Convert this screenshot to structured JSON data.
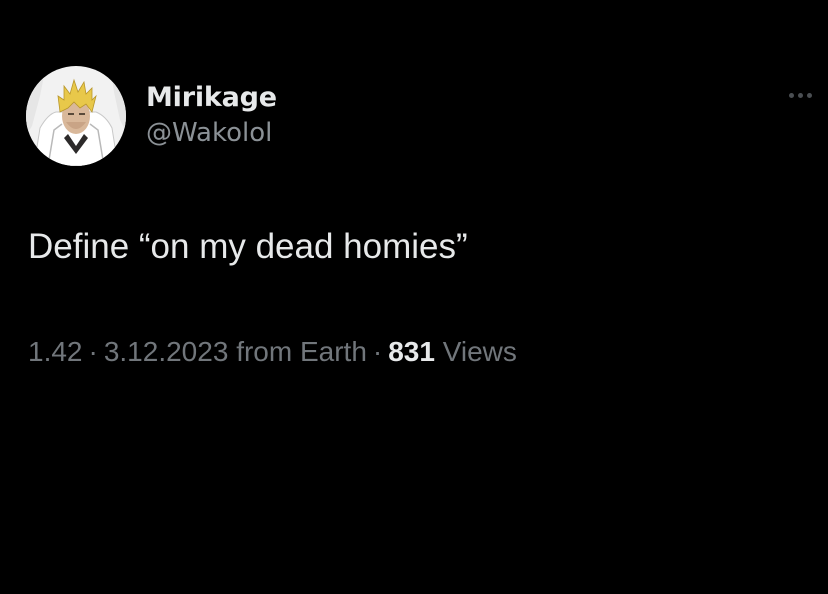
{
  "author": {
    "display_name": "Mirikage",
    "handle": "@Wakolol",
    "avatar_icon": "avatar-blond-character"
  },
  "more_icon": "more-horizontal-icon",
  "tweet": {
    "text": "Define “on my dead homies”"
  },
  "meta": {
    "time": "1.42",
    "separator": "·",
    "date": "3.12.2023",
    "source": "from Earth",
    "views_count": "831",
    "views_label": "Views"
  },
  "colors": {
    "background": "#000000",
    "primary_text": "#e7e9ea",
    "secondary_text": "#71767b"
  }
}
